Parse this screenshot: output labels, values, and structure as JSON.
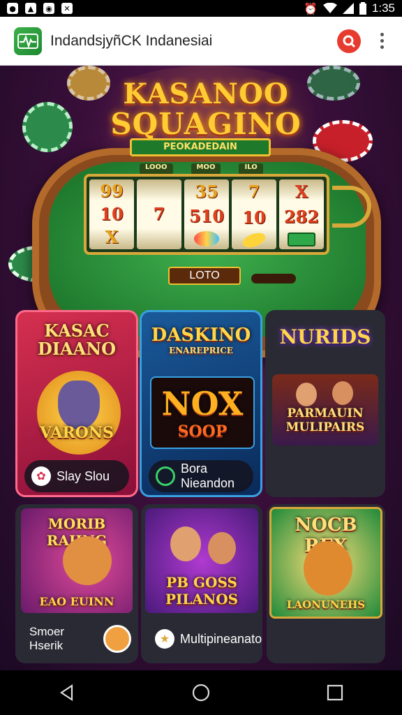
{
  "status_bar": {
    "time": "1:35",
    "icons": [
      "notification-icon",
      "image-icon",
      "app-icon",
      "settings-icon"
    ],
    "right_icons": [
      "alarm-icon",
      "wifi-icon",
      "signal-icon",
      "battery-icon"
    ]
  },
  "app_bar": {
    "title": "IndandsjyñCK Indanesiai",
    "logo_icon": "pulse-icon",
    "action_icon": "record-icon",
    "menu_icon": "more-vert-icon"
  },
  "hero": {
    "title_line1": "KASANOO",
    "title_line2": "SQUAGINO",
    "plaque": "PEOKADEDAIN",
    "reel_header": [
      "LOOO",
      "MOO",
      "ILO"
    ],
    "reels": [
      [
        "99",
        "10",
        "X"
      ],
      [
        "",
        "7",
        ""
      ],
      [
        "35",
        "510",
        ""
      ],
      [
        "7",
        "10",
        ""
      ],
      [
        "X",
        "282",
        ""
      ]
    ],
    "button": "LOTO"
  },
  "cards": [
    {
      "title": "KASAC DIAANO",
      "art_text": "VARONS",
      "label": "Slay Slou",
      "icon": "dice-icon",
      "accent": "#e0307a"
    },
    {
      "title": "DASKINO",
      "subtitle": "ENAREPRICE",
      "art_text": "NOX",
      "art_sub": "SOOP",
      "label": "Bora Nieandon",
      "icon": "chat-icon",
      "accent": "#1e88e5"
    },
    {
      "title": "NURIDS",
      "art_text": "PARMAUIN MULIPAIRS",
      "label": "",
      "icon": "",
      "accent": "#333"
    },
    {
      "title": "MORIB RAIING",
      "art_text": "EAO EUINN",
      "label": "Smoer Hserik",
      "icon": "chat-bubble-icon",
      "accent": "#ffffff"
    },
    {
      "title": "",
      "art_text": "PB GOSS PILANOS",
      "label": "Multipineanator",
      "icon": "star-icon",
      "accent": "#ffffff"
    },
    {
      "title": "NOCB REX",
      "art_text": "LAONUNEHS",
      "label": "",
      "icon": "",
      "accent": "#d9a83a"
    }
  ],
  "nav": {
    "back": "back-icon",
    "home": "home-icon",
    "recents": "recents-icon"
  }
}
